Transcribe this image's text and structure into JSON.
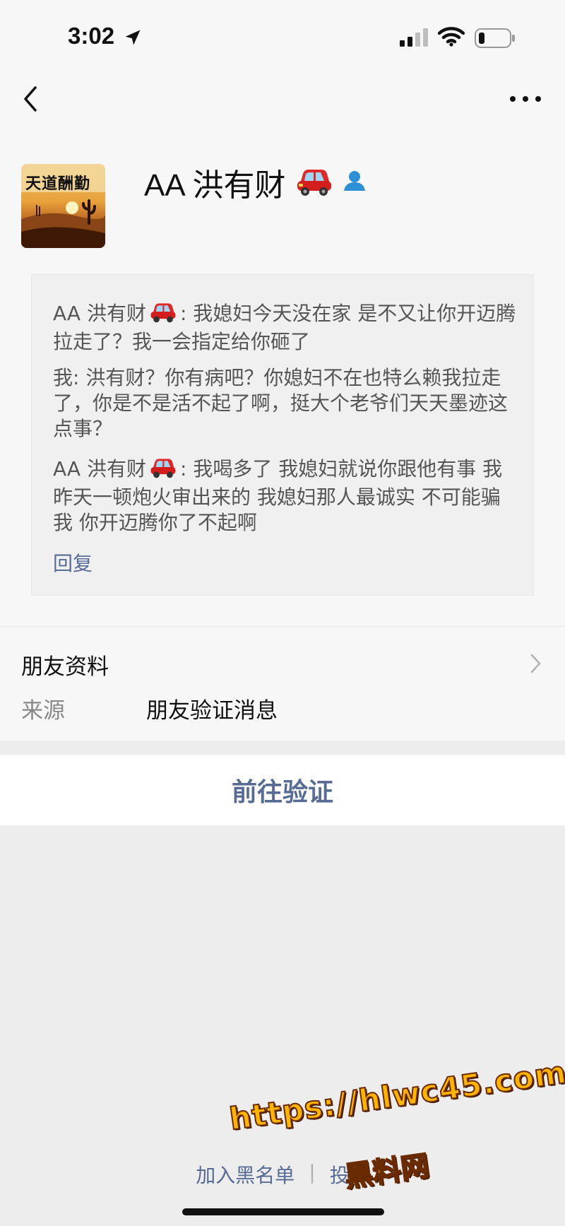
{
  "status_bar": {
    "time": "3:02",
    "icons": [
      "location-arrow-icon",
      "cellular-signal-icon",
      "wifi-icon",
      "battery-icon"
    ]
  },
  "nav": {
    "back_icon": "chevron-left-icon",
    "more_icon": "more-dots-icon"
  },
  "profile": {
    "name": "AA 洪有财",
    "avatar_text": "天道酬勤",
    "name_emoji": "red-car-icon",
    "badge_icon": "contact-person-icon"
  },
  "messages": [
    {
      "sender": "AA 洪有财",
      "has_car_emoji": true,
      "text": ": 我媳妇今天没在家 是不又让你开迈腾拉走了？我一会指定给你砸了"
    },
    {
      "sender": "我",
      "has_car_emoji": false,
      "text": ": 洪有财？你有病吧？你媳妇不在也特么赖我拉走了，你是不是活不起了啊，挺大个老爷们天天墨迹这点事？"
    },
    {
      "sender": "AA 洪有财",
      "has_car_emoji": true,
      "text": ": 我喝多了 我媳妇就说你跟他有事 我昨天一顿炮火审出来的 我媳妇那人最诚实 不可能骗我 你开迈腾你了不起啊"
    }
  ],
  "reply_label": "回复",
  "friend_info": {
    "title": "朋友资料",
    "source_label": "来源",
    "source_value": "朋友验证消息"
  },
  "verify_button": "前往验证",
  "bottom_links": {
    "blacklist": "加入黑名单",
    "separator": "|",
    "report": "投诉"
  },
  "watermark": {
    "url": "https://hlwc45.com",
    "text": "黑料网"
  },
  "colors": {
    "link": "#576b95",
    "page_bg": "#ededed",
    "card_bg": "#f0f0f0",
    "watermark": "#ffb400"
  }
}
